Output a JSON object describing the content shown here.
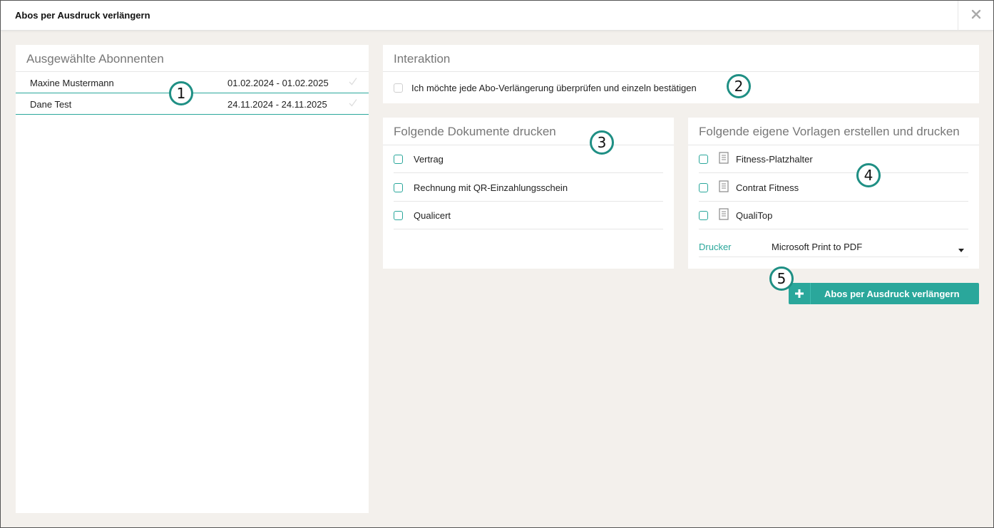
{
  "window": {
    "title": "Abos per Ausdruck verlängern",
    "close_icon": "close-icon"
  },
  "subscribers": {
    "title": "Ausgewählte Abonnenten",
    "rows": [
      {
        "name": "Maxine Mustermann",
        "period": "01.02.2024 - 01.02.2025"
      },
      {
        "name": "Dane Test",
        "period": "24.11.2024 - 24.11.2025"
      }
    ]
  },
  "interaction": {
    "title": "Interaktion",
    "checkbox_label": "Ich möchte jede Abo-Verlängerung überprüfen und einzeln bestätigen"
  },
  "documents": {
    "title": "Folgende Dokumente drucken",
    "items": [
      "Vertrag",
      "Rechnung mit QR-Einzahlungsschein",
      "Qualicert"
    ]
  },
  "templates": {
    "title": "Folgende eigene Vorlagen erstellen und drucken",
    "items": [
      "Fitness-Platzhalter",
      "Contrat Fitness",
      "QualiTop"
    ],
    "printer_label": "Drucker",
    "printer_value": "Microsoft Print to PDF"
  },
  "action": {
    "label": "Abos per Ausdruck verlängern"
  },
  "markers": [
    "1",
    "2",
    "3",
    "4",
    "5"
  ],
  "colors": {
    "accent": "#2aa79b",
    "background": "#f3f0ec"
  }
}
